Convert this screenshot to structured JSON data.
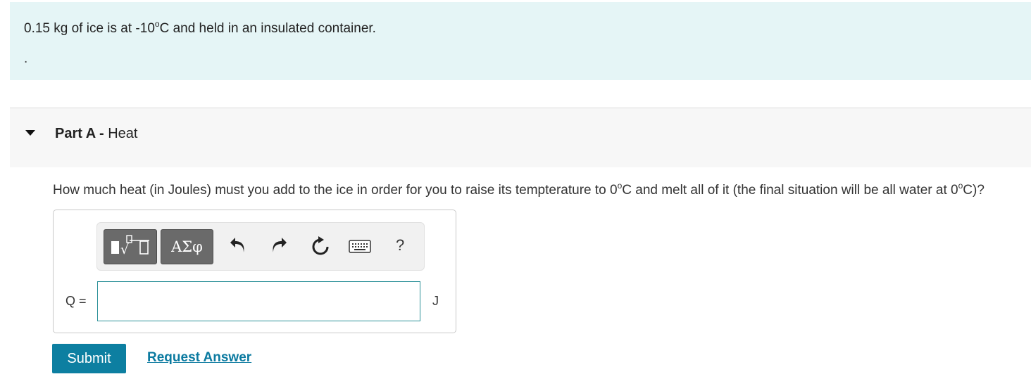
{
  "problem": {
    "intro_before": "0.15 kg of ice is at -10",
    "intro_sup": "o",
    "intro_after": "C and held in an insulated container.",
    "intro_dot": "."
  },
  "part": {
    "label": "Part A -",
    "title": "Heat",
    "expanded": true
  },
  "question": {
    "text_1": "How much heat (in Joules) must you add to the ice in order for you to raise its tempterature to 0",
    "sup_1": "o",
    "text_2": "C and melt all of it (the final situation will be all water at 0",
    "sup_2": "o",
    "text_3": "C)?"
  },
  "toolbar": {
    "templates_icon": "templates-icon",
    "symbols_label": "ΑΣφ",
    "undo_icon": "undo-icon",
    "redo_icon": "redo-icon",
    "reset_icon": "reset-icon",
    "keyboard_icon": "keyboard-icon",
    "help_label": "?"
  },
  "answer": {
    "variable_label": "Q =",
    "value": "",
    "unit": "J"
  },
  "actions": {
    "submit_label": "Submit",
    "request_answer_label": "Request Answer"
  },
  "colors": {
    "intro_bg": "#e5f5f6",
    "accent": "#0d7fa1",
    "input_border": "#2d9199"
  }
}
